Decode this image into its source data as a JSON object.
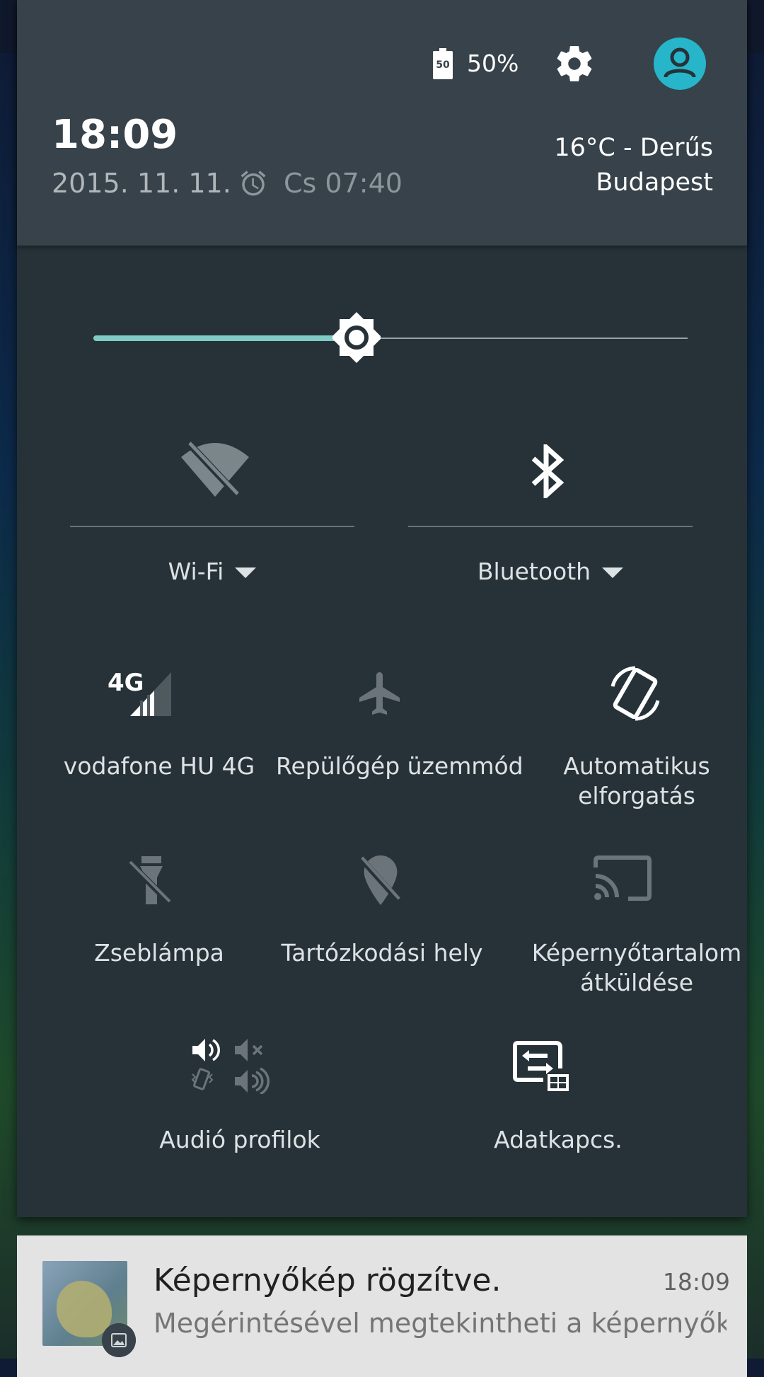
{
  "colors": {
    "header_bg": "#37424a",
    "panel_bg": "#263238",
    "accent": "#80cbc4",
    "avatar": "#26b5c9",
    "notification_bg": "#e3e3e3"
  },
  "status": {
    "battery_icon_label": "50",
    "battery_percent": "50%",
    "icons": [
      "battery-icon",
      "gear-icon",
      "avatar-icon"
    ]
  },
  "header": {
    "time": "18:09",
    "date": "2015. 11. 11.",
    "alarm_time": "Cs 07:40",
    "weather": "16°C - Derűs",
    "city": "Budapest"
  },
  "brightness": {
    "level": 0.455,
    "icon": "brightness-icon"
  },
  "tiles": {
    "wifi": {
      "label": "Wi-Fi",
      "icon": "wifi-off-icon",
      "state": "off"
    },
    "bluetooth": {
      "label": "Bluetooth",
      "icon": "bluetooth-icon",
      "state": "on"
    },
    "mobile": {
      "label": "vodafone HU 4G",
      "icon": "signal-4g-icon",
      "badge": "4G"
    },
    "airplane": {
      "label": "Repülőgép üzemmód",
      "icon": "airplane-icon",
      "state": "off"
    },
    "rotation": {
      "label1": "Automatikus",
      "label2": "elforgatás",
      "icon": "auto-rotate-icon",
      "state": "on"
    },
    "flashlight": {
      "label": "Zseblámpa",
      "icon": "flashlight-off-icon",
      "state": "off"
    },
    "location": {
      "label": "Tartózkodási hely",
      "icon": "location-off-icon",
      "state": "off"
    },
    "cast": {
      "label1": "Képernyőtartalom",
      "label2": "átküldése",
      "icon": "cast-icon",
      "state": "off"
    },
    "audio": {
      "label": "Audió profilok",
      "icon": "audio-profiles-icon"
    },
    "data": {
      "label": "Adatkapcs.",
      "icon": "data-switch-icon"
    }
  },
  "notification": {
    "title": "Képernyőkép rögzítve.",
    "time": "18:09",
    "text": "Megérintésével megtekintheti a képernyőképet."
  }
}
